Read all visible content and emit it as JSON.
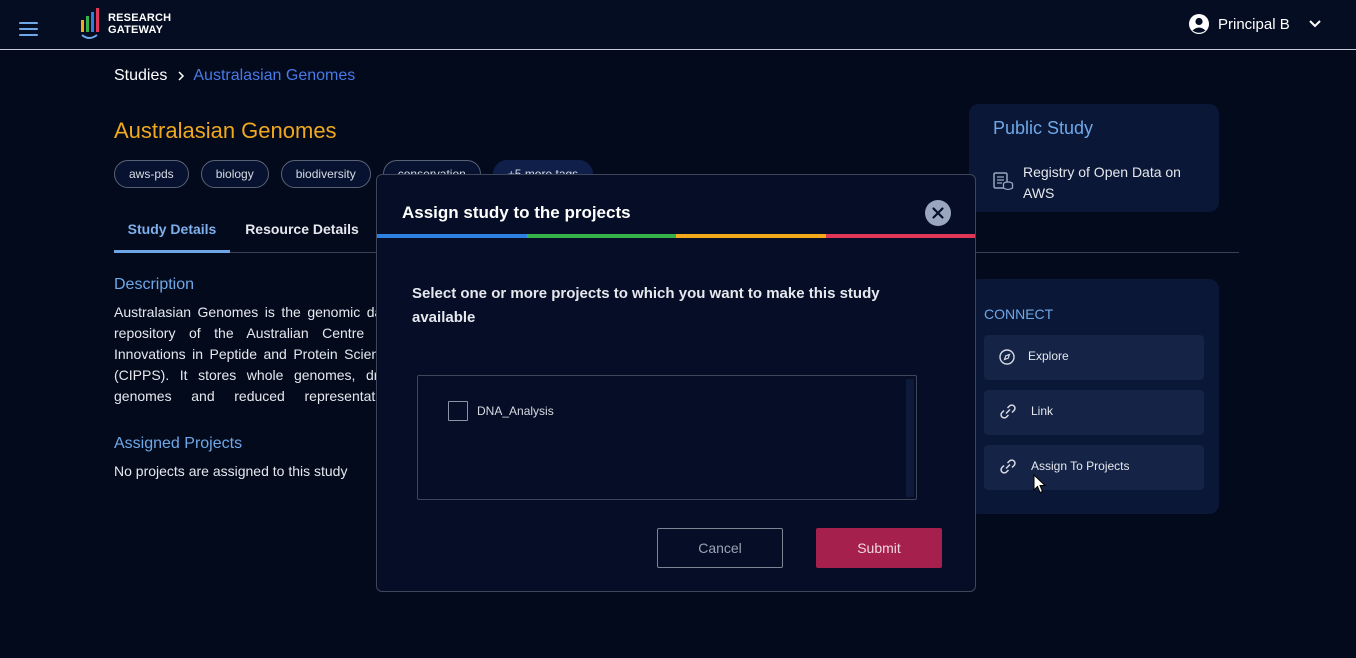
{
  "header": {
    "logo_text_line1": "RESEARCH",
    "logo_text_line2": "GATEWAY",
    "user_name": "Principal B"
  },
  "breadcrumb": {
    "root": "Studies",
    "current": "Australasian Genomes"
  },
  "study": {
    "title": "Australasian Genomes",
    "tags": [
      "aws-pds",
      "biology",
      "biodiversity",
      "conservation",
      "+5 more tags"
    ],
    "tabs": [
      "Study Details",
      "Resource Details"
    ],
    "description_heading": "Description",
    "description": "Australasian Genomes is the genomic data repository of the Australian Centre for Innovations in Peptide and Protein Science (CIPPS). It stores whole genomes, draft genomes and reduced representation sequencing data generated by the Australasian Wildlife Genomics Group (AWGG) and partners of CIPPS.",
    "assigned_heading": "Assigned Projects",
    "assigned_empty": "No projects are assigned to this study"
  },
  "public_card": {
    "title": "Public Study",
    "registry": "Registry of Open Data on AWS"
  },
  "connect": {
    "title": "CONNECT",
    "buttons": [
      "Explore",
      "Link",
      "Assign To Projects"
    ]
  },
  "modal": {
    "title": "Assign study to the projects",
    "prompt": "Select one or more projects to which you want to make this study available",
    "projects": [
      {
        "name": "DNA_Analysis",
        "checked": false
      }
    ],
    "cancel_label": "Cancel",
    "submit_label": "Submit"
  },
  "colors": {
    "background": "#020a1c",
    "accent_blue": "#6fa8e8",
    "title_orange": "#f0a81e",
    "submit": "#a5204c",
    "rainbow": [
      "#2f7fe0",
      "#35b24a",
      "#f2a91a",
      "#e03658"
    ]
  },
  "icons": {
    "menu": "hamburger-icon",
    "user": "user-circle-icon",
    "chevron": "chevron-down-icon",
    "close": "close-icon",
    "registry": "registry-icon",
    "explore": "compass-icon",
    "link": "link-icon"
  }
}
